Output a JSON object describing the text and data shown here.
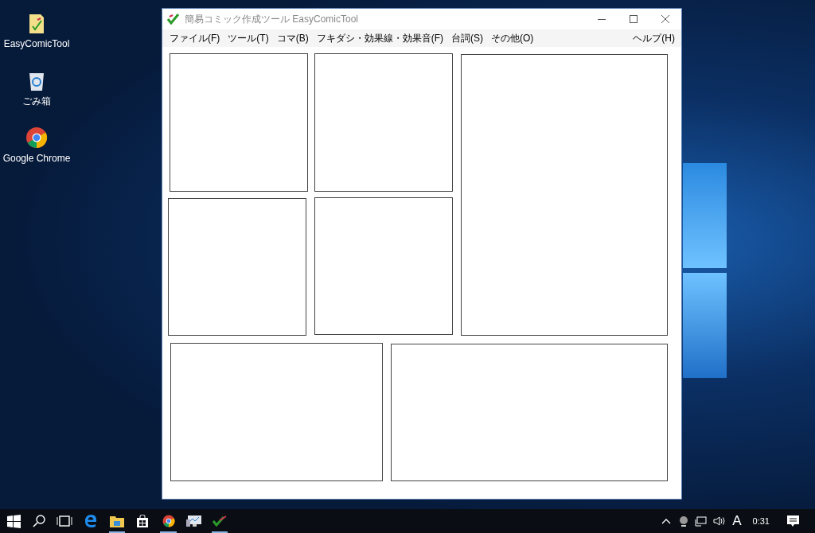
{
  "desktop_icons": [
    {
      "kind": "app",
      "label": "EasyComicTool"
    },
    {
      "kind": "recycle",
      "label": "ごみ箱"
    },
    {
      "kind": "chrome",
      "label": "Google Chrome"
    }
  ],
  "window": {
    "title": "簡易コミック作成ツール EasyComicTool"
  },
  "menu": {
    "items": [
      "ファイル(F)",
      "ツール(T)",
      "コマ(B)",
      "フキダシ・効果線・効果音(F)",
      "台詞(S)",
      "その他(O)"
    ],
    "help": "ヘルプ(H)"
  },
  "taskbar": {
    "items": [
      {
        "kind": "start",
        "running": false
      },
      {
        "kind": "search",
        "running": false
      },
      {
        "kind": "taskview",
        "running": false
      },
      {
        "kind": "edge",
        "running": false
      },
      {
        "kind": "explorer",
        "running": true
      },
      {
        "kind": "store",
        "running": false
      },
      {
        "kind": "chrome",
        "running": true
      },
      {
        "kind": "monitor",
        "running": false
      },
      {
        "kind": "comic",
        "running": true
      }
    ],
    "ime": "A",
    "clock": "0:31"
  }
}
